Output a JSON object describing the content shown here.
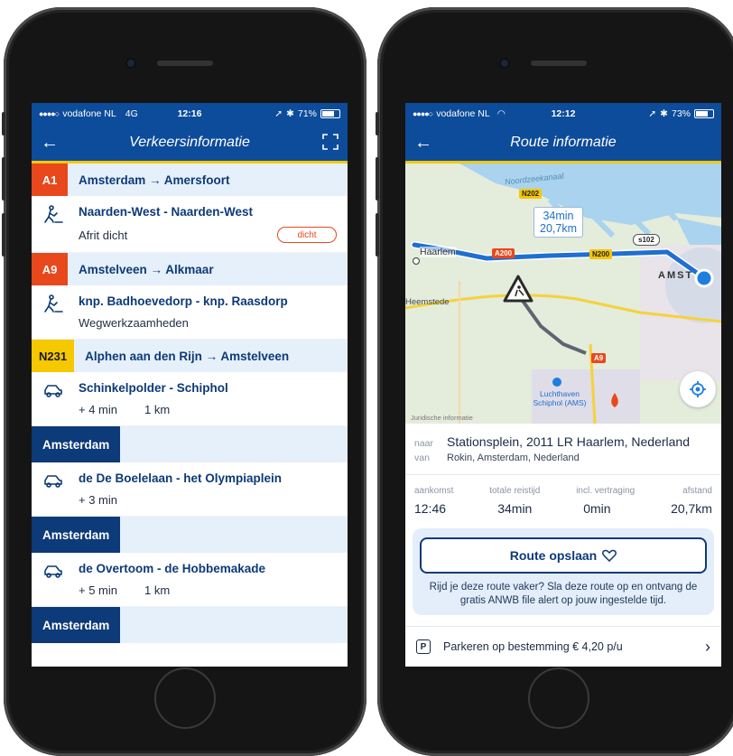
{
  "left": {
    "status": {
      "carrier": "vodafone NL",
      "network": "4G",
      "time": "12:16",
      "battery": "71%",
      "battery_level": 0.71
    },
    "nav": {
      "title": "Verkeersinformatie"
    },
    "sections": [
      {
        "badge": "A1",
        "route": "Amsterdam → Amersfoort",
        "items": [
          {
            "icon": "roadwork-icon",
            "name": "Naarden-West - Naarden-West",
            "detail": "Afrit dicht",
            "status": "dicht"
          }
        ]
      },
      {
        "badge": "A9",
        "route": "Amstelveen → Alkmaar",
        "items": [
          {
            "icon": "roadwork-icon",
            "name": "knp. Badhoevedorp - knp. Raasdorp",
            "detail": "Wegwerkzaamheden"
          }
        ]
      },
      {
        "badge": "N231",
        "route": "Alphen aan den Rijn → Amstelveen",
        "items": [
          {
            "icon": "car-icon",
            "name": "Schinkelpolder - Schiphol",
            "delay": "+ 4 min",
            "length": "1 km"
          }
        ]
      },
      {
        "city": "Amsterdam",
        "items": [
          {
            "icon": "car-icon",
            "name": "de De Boelelaan - het Olympiaplein",
            "delay": "+ 3 min"
          }
        ]
      },
      {
        "city": "Amsterdam",
        "items": [
          {
            "icon": "car-icon",
            "name": "de Overtoom - de Hobbemakade",
            "delay": "+ 5 min",
            "length": "1 km"
          }
        ]
      },
      {
        "city": "Amsterdam"
      }
    ]
  },
  "right": {
    "status": {
      "carrier": "vodafone NL",
      "time": "12:12",
      "battery": "73%",
      "battery_level": 0.73
    },
    "nav": {
      "title": "Route informatie"
    },
    "map": {
      "labels": {
        "canal": "Noordzeekanaal",
        "haarlem": "Haarlem",
        "heemstede": "Heemstede",
        "amsterdam": "AMST",
        "airport_1": "Luchthaven",
        "airport_2": "Schiphol (AMS)",
        "legal": "Juridische informatie"
      },
      "roads": {
        "n202": "N202",
        "a200": "A200",
        "n200": "N200",
        "s102": "s102",
        "a9": "A9"
      },
      "callout": {
        "time": "34min",
        "distance": "20,7km"
      }
    },
    "route": {
      "to_label": "naar",
      "to": "Stationsplein, 2011 LR Haarlem, Nederland",
      "from_label": "van",
      "from": "Rokin, Amsterdam, Nederland"
    },
    "stats": [
      {
        "label": "aankomst",
        "value": "12:46"
      },
      {
        "label": "totale reistijd",
        "value": "34min"
      },
      {
        "label": "incl. vertraging",
        "value": "0min"
      },
      {
        "label": "afstand",
        "value": "20,7km"
      }
    ],
    "promo": {
      "button": "Route opslaan",
      "text": "Rijd je deze route vaker? Sla deze route op en ontvang de gratis ANWB file alert op jouw ingestelde tijd."
    },
    "parking": {
      "text": "Parkeren op bestemming € 4,20 p/u"
    },
    "colors": {
      "brand_blue": "#0d4c9a",
      "accent_yellow": "#f5c800",
      "road_red": "#e8481c"
    }
  }
}
